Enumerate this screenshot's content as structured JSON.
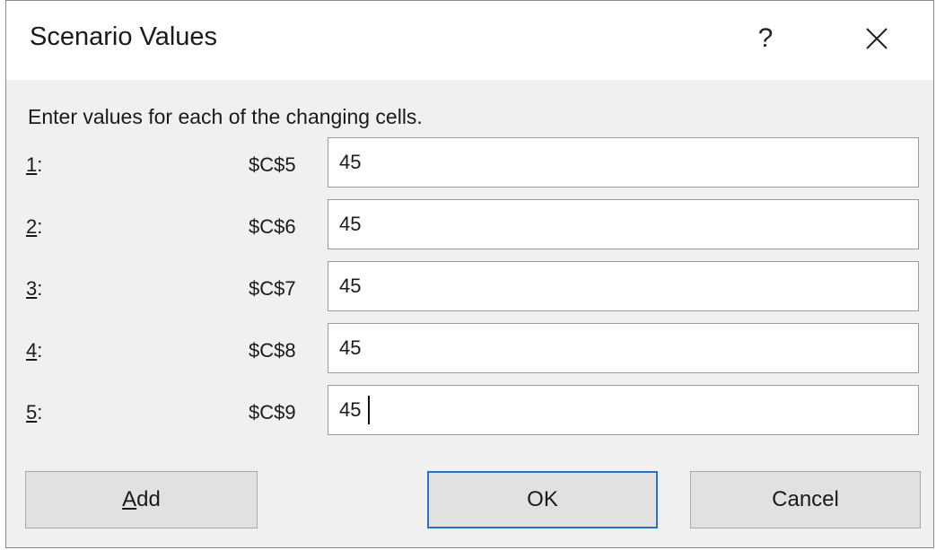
{
  "dialog": {
    "title": "Scenario Values",
    "help_label": "?",
    "instruction": "Enter values for each of the changing cells."
  },
  "rows": [
    {
      "num": "1",
      "suffix": ":",
      "cell": "$C$5",
      "value": "45"
    },
    {
      "num": "2",
      "suffix": ":",
      "cell": "$C$6",
      "value": "45"
    },
    {
      "num": "3",
      "suffix": ":",
      "cell": "$C$7",
      "value": "45"
    },
    {
      "num": "4",
      "suffix": ":",
      "cell": "$C$8",
      "value": "45"
    },
    {
      "num": "5",
      "suffix": ":",
      "cell": "$C$9",
      "value": "45"
    }
  ],
  "buttons": {
    "add_mnemonic": "A",
    "add_rest": "dd",
    "ok": "OK",
    "cancel": "Cancel"
  },
  "colors": {
    "dialog_bg": "#f0f0f0",
    "default_button_border": "#2a72c8"
  },
  "icons": {
    "close": "close-icon"
  }
}
